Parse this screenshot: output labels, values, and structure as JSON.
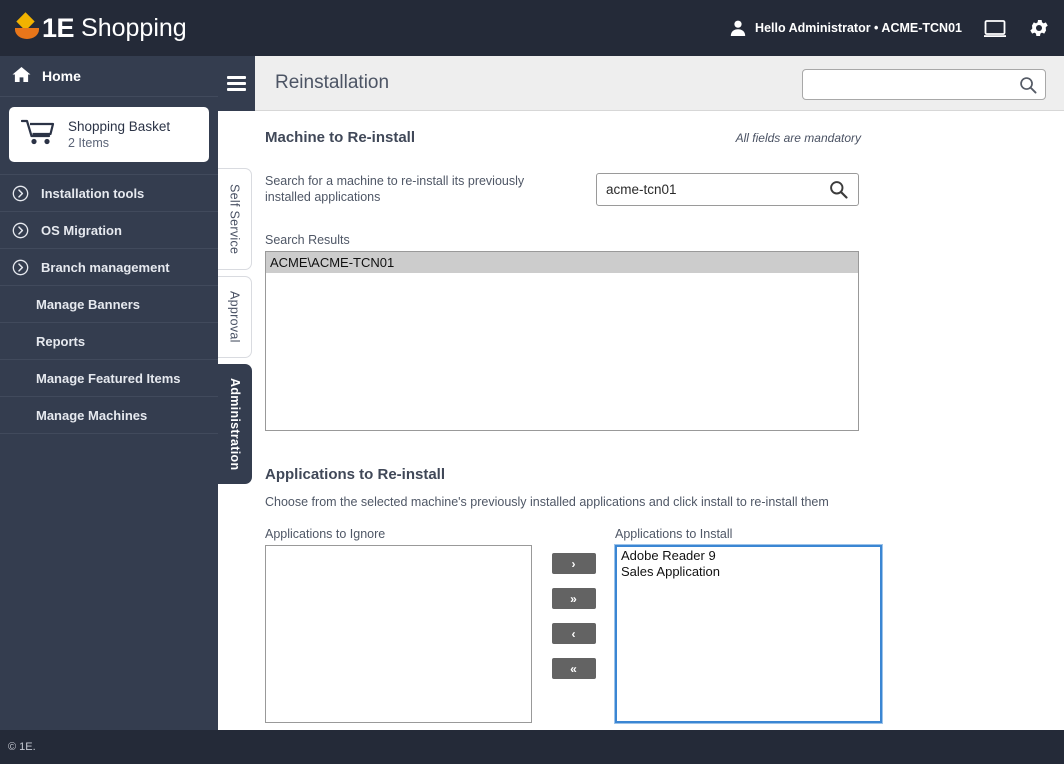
{
  "topbar": {
    "logo_text_1e": "1E",
    "logo_text_word": "Shopping",
    "user_greeting": "Hello Administrator • ACME-TCN01",
    "user_icon": "person-icon",
    "monitor_icon": "monitor-icon",
    "settings_icon": "gear-icon"
  },
  "sidebar": {
    "home_label": "Home",
    "home_icon": "house-icon",
    "basket": {
      "icon": "shopping-cart-icon",
      "title": "Shopping Basket",
      "count": "2 Items"
    },
    "items": [
      {
        "label": "Installation tools",
        "icon": "chevron-right-circle-icon",
        "has_icon": true
      },
      {
        "label": "OS Migration",
        "icon": "chevron-right-circle-icon",
        "has_icon": true
      },
      {
        "label": "Branch management",
        "icon": "chevron-right-circle-icon",
        "has_icon": true
      },
      {
        "label": "Manage Banners",
        "icon": "",
        "has_icon": false
      },
      {
        "label": "Reports",
        "icon": "",
        "has_icon": false
      },
      {
        "label": "Manage Featured Items",
        "icon": "",
        "has_icon": false
      },
      {
        "label": "Manage Machines",
        "icon": "",
        "has_icon": false
      }
    ]
  },
  "vertical_tabs": [
    {
      "label": "Self Service",
      "active": false
    },
    {
      "label": "Approval",
      "active": false
    },
    {
      "label": "Administration",
      "active": true
    }
  ],
  "content_header": {
    "menu_icon": "hamburger-menu-icon",
    "page_title": "Reinstallation",
    "search_value": "",
    "search_placeholder": "",
    "search_icon": "search-icon"
  },
  "machine_section": {
    "title": "Machine to Re-install",
    "mandatory_note": "All fields are mandatory",
    "search_label": "Search for a machine to re-install its previously installed applications",
    "search_value": "acme-tcn01",
    "search_placeholder": "",
    "search_icon": "search-icon",
    "results_label": "Search Results",
    "results": [
      "ACME\\ACME-TCN01"
    ]
  },
  "apps_section": {
    "title": "Applications to Re-install",
    "description": "Choose from the selected machine's previously installed applications and click install to re-install them",
    "ignore_label": "Applications to Ignore",
    "ignore_items": [],
    "install_label": "Applications to Install",
    "install_items": [
      "Adobe Reader 9",
      "Sales Application"
    ],
    "buttons": [
      {
        "label": "›",
        "name": "move-right-one-button"
      },
      {
        "label": "»",
        "name": "move-right-all-button"
      },
      {
        "label": "‹",
        "name": "move-left-one-button"
      },
      {
        "label": "«",
        "name": "move-left-all-button"
      }
    ]
  },
  "footer": {
    "copyright": "© 1E."
  },
  "colors": {
    "topbar_bg": "#242a38",
    "sidebar_bg": "#343d4f",
    "accent_gold": "#f2b300",
    "accent_orange": "#e8761a",
    "focus_blue": "#3b86d3",
    "selection_grey": "#cccccc"
  }
}
